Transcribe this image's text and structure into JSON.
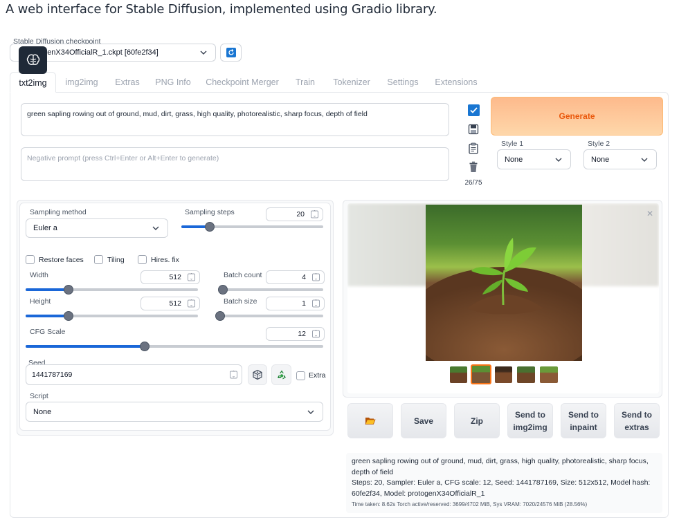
{
  "page": {
    "title": "A web interface for Stable Diffusion, implemented using Gradio library."
  },
  "checkpoint": {
    "label": "Stable Diffusion checkpoint",
    "value": "protogenX34OfficialR_1.ckpt [60fe2f34]"
  },
  "tabs": [
    {
      "label": "txt2img"
    },
    {
      "label": "img2img"
    },
    {
      "label": "Extras"
    },
    {
      "label": "PNG Info"
    },
    {
      "label": "Checkpoint Merger"
    },
    {
      "label": "Train"
    },
    {
      "label": "Tokenizer"
    },
    {
      "label": "Settings"
    },
    {
      "label": "Extensions"
    }
  ],
  "prompt": {
    "value": "green sapling rowing out of ground, mud, dirt, grass, high quality, photorealistic, sharp focus, depth of field"
  },
  "negative_prompt": {
    "placeholder": "Negative prompt (press Ctrl+Enter or Alt+Enter to generate)"
  },
  "token_count": "26/75",
  "generate": {
    "label": "Generate"
  },
  "styles": {
    "style1_label": "Style 1",
    "style1_value": "None",
    "style2_label": "Style 2",
    "style2_value": "None"
  },
  "sampling": {
    "method_label": "Sampling method",
    "method_value": "Euler a",
    "steps_label": "Sampling steps",
    "steps_value": "20"
  },
  "options": {
    "restore_faces": "Restore faces",
    "tiling": "Tiling",
    "hires_fix": "Hires. fix"
  },
  "size": {
    "width_label": "Width",
    "width_value": "512",
    "height_label": "Height",
    "height_value": "512"
  },
  "batch": {
    "count_label": "Batch count",
    "count_value": "4",
    "size_label": "Batch size",
    "size_value": "1"
  },
  "cfg": {
    "label": "CFG Scale",
    "value": "12"
  },
  "slider_levels": {
    "sampling_steps": 0.2,
    "width": 0.25,
    "height": 0.25,
    "batch_count": 0.03,
    "batch_size": 0.0,
    "cfg_scale": 0.4
  },
  "seed": {
    "label": "Seed",
    "value": "1441787169",
    "extra_label": "Extra"
  },
  "script": {
    "label": "Script",
    "value": "None"
  },
  "actions": {
    "save": "Save",
    "zip": "Zip",
    "send_img2img": "Send to img2img",
    "send_inpaint": "Send to inpaint",
    "send_extras": "Send to extras"
  },
  "output_info": {
    "prompt": "green sapling rowing out of ground, mud, dirt, grass, high quality, photorealistic, sharp focus, depth of field",
    "params": "Steps: 20, Sampler: Euler a, CFG scale: 12, Seed: 1441787169, Size: 512x512, Model hash: 60fe2f34, Model: protogenX34OfficialR_1",
    "timing": "Time taken: 8.62s  Torch active/reserved: 3699/4702 MiB, Sys VRAM: 7020/24576 MiB (28.56%)"
  },
  "icons": {
    "refresh": "refresh-icon",
    "brain": "brain-icon",
    "checkbox": "checkbox-icon",
    "save": "floppy-disk-icon",
    "paste": "clipboard-icon",
    "trash": "trash-icon",
    "dice": "dice-icon",
    "recycle": "recycle-icon",
    "folder": "folder-icon",
    "close": "close-icon",
    "chevron": "chevron-down-icon"
  },
  "colors": {
    "accent": "#1a67d8",
    "generate_from": "#fdba8c",
    "generate_to": "#fed7aa",
    "generate_text": "#ea580c"
  }
}
